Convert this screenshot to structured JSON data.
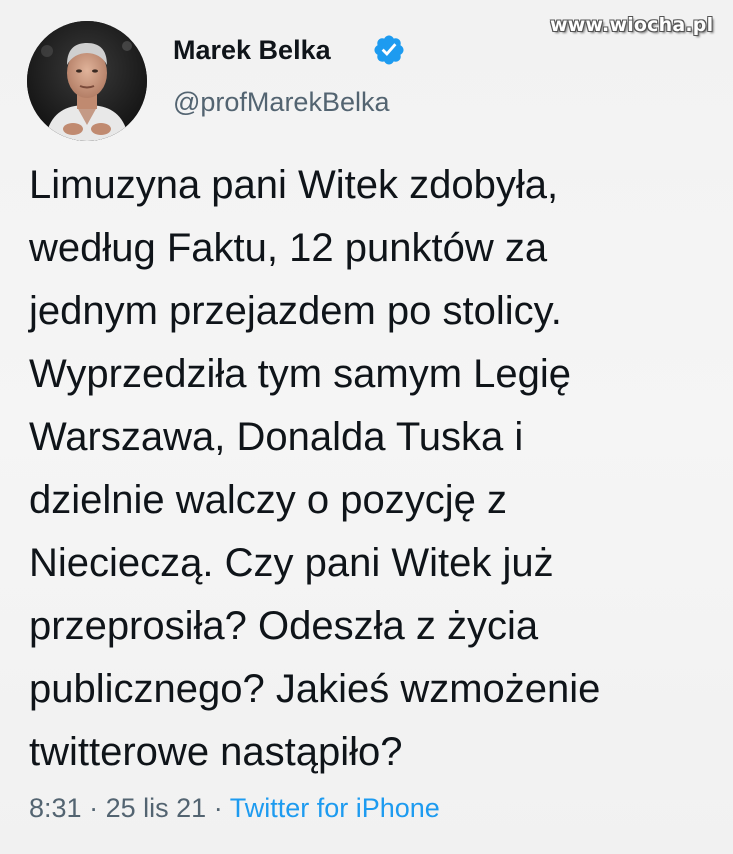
{
  "watermark": "www.wiocha.pl",
  "author": {
    "name": "Marek Belka",
    "handle": "@profMarekBelka",
    "verified": true,
    "verified_icon": "verified-badge-icon",
    "avatar_icon": "profile-photo"
  },
  "tweet": {
    "lines": [
      "Limuzyna pani Witek zdobyła,",
      "według Faktu, 12 punktów za",
      "jednym przejazdem po stolicy.",
      "Wyprzedziła tym samym Legię",
      "Warszawa, Donalda Tuska i",
      "dzielnie walczy o pozycję z",
      "Niecieczą. Czy pani Witek już",
      "przeprosiła? Odeszła z życia",
      "publicznego? Jakieś wzmożenie",
      "twitterowe nastąpiło?"
    ]
  },
  "meta": {
    "time": "8:31",
    "separator": "·",
    "date": "25 lis 21",
    "source": "Twitter for iPhone"
  },
  "colors": {
    "background": "#f3f3f3",
    "text": "#0f1419",
    "secondary": "#536471",
    "accent": "#1d9bf0"
  }
}
